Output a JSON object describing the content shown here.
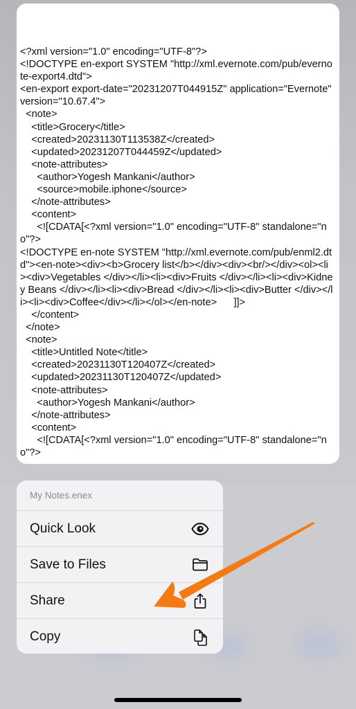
{
  "preview": {
    "xml_lines": [
      "<?xml version=\"1.0\" encoding=\"UTF-8\"?>",
      "<!DOCTYPE en-export SYSTEM \"http://xml.evernote.com/pub/evernote-export4.dtd\">",
      "<en-export export-date=\"20231207T044915Z\" application=\"Evernote\" version=\"10.67.4\">",
      "  <note>",
      "    <title>Grocery</title>",
      "    <created>20231130T113538Z</created>",
      "    <updated>20231207T044459Z</updated>",
      "    <note-attributes>",
      "      <author>Yogesh Mankani</author>",
      "      <source>mobile.iphone</source>",
      "    </note-attributes>",
      "    <content>",
      "      <![CDATA[<?xml version=\"1.0\" encoding=\"UTF-8\" standalone=\"no\"?>",
      "<!DOCTYPE en-note SYSTEM \"http://xml.evernote.com/pub/enml2.dtd\"><en-note><div><b>Grocery list</b></div><div><br/></div><ol><li><div>Vegetables </div></li><li><div>Fruits </div></li><li><div>Kidney Beans </div></li><li><div>Bread </div></li><li><div>Butter </div></li><li><div>Coffee</div></li></ol></en-note>      ]]>",
      "    </content>",
      "  </note>",
      "  <note>",
      "    <title>Untitled Note</title>",
      "    <created>20231130T120407Z</created>",
      "    <updated>20231130T120407Z</updated>",
      "    <note-attributes>",
      "      <author>Yogesh Mankani</author>",
      "    </note-attributes>",
      "    <content>",
      "      <![CDATA[<?xml version=\"1.0\" encoding=\"UTF-8\" standalone=\"no\"?>"
    ]
  },
  "menu": {
    "file_name": "My Notes.enex",
    "items": [
      {
        "label": "Quick Look",
        "icon": "eye-icon"
      },
      {
        "label": "Save to Files",
        "icon": "folder-icon"
      },
      {
        "label": "Share",
        "icon": "share-icon"
      },
      {
        "label": "Copy",
        "icon": "copy-icon"
      }
    ]
  },
  "annotation": {
    "color": "#f47a14",
    "points_to": "Share"
  }
}
